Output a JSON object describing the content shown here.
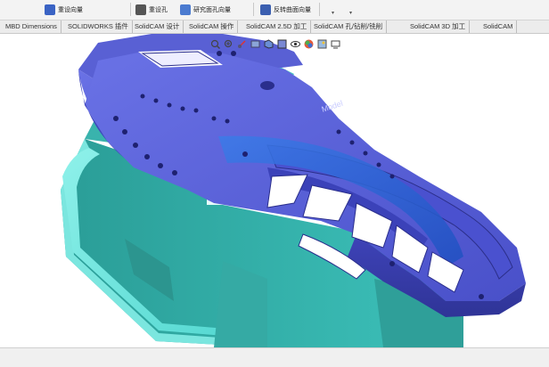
{
  "ribbon": {
    "buttons": [
      {
        "label": "重设向量",
        "icon": "vector-icon",
        "color": "#3a63c4"
      },
      {
        "label": "重设孔",
        "icon": "hole-icon",
        "color": "#444444"
      },
      {
        "label": "研究面孔向量",
        "icon": "face-vector-icon",
        "color": "#4b7bd0"
      },
      {
        "label": "反转曲面向量",
        "icon": "flip-surface-icon",
        "color": "#3b5fb0"
      }
    ]
  },
  "tabs": [
    "MBD Dimensions",
    "SOLIDWORKS 插件",
    "SolidCAM 设计",
    "SolidCAM 操作",
    "SolidCAM 2.5D 加工",
    "SolidCAM 孔/钻削/铣削",
    "SolidCAM 3D 加工",
    "SolidCAM"
  ],
  "view_toolbar": {
    "icons": [
      "zoom-fit-icon",
      "zoom-area-icon",
      "previous-view-icon",
      "section-view-icon",
      "view-orientation-icon",
      "display-style-icon",
      "hide-show-icon",
      "appearance-icon",
      "scene-icon",
      "display-settings-icon"
    ]
  },
  "model": {
    "part_color": "#5a63d8",
    "fixture_color": "#3fc6c0",
    "engraving_text": "Model"
  }
}
